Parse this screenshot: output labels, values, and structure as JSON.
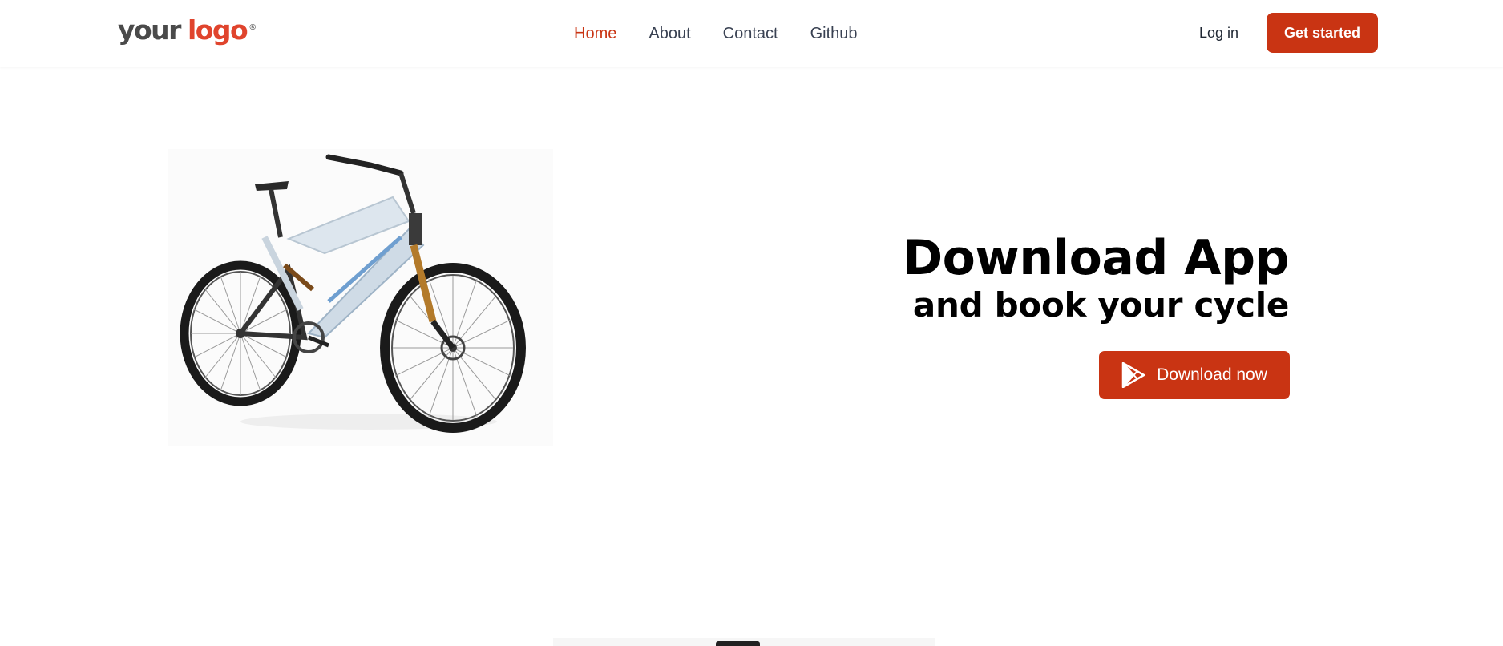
{
  "brand": {
    "logo_word1": "your",
    "logo_word2": "logo",
    "logo_mark": "®",
    "accent": "#c93413"
  },
  "nav": {
    "links": [
      {
        "label": "Home",
        "active": true
      },
      {
        "label": "About"
      },
      {
        "label": "Contact"
      },
      {
        "label": "Github"
      }
    ],
    "login_label": "Log in",
    "cta_label": "Get started"
  },
  "hero": {
    "image_alt": "mountain bike",
    "title": "Download App",
    "subtitle": "and book your cycle",
    "button_icon": "play-store-icon",
    "button_label": "Download now"
  }
}
